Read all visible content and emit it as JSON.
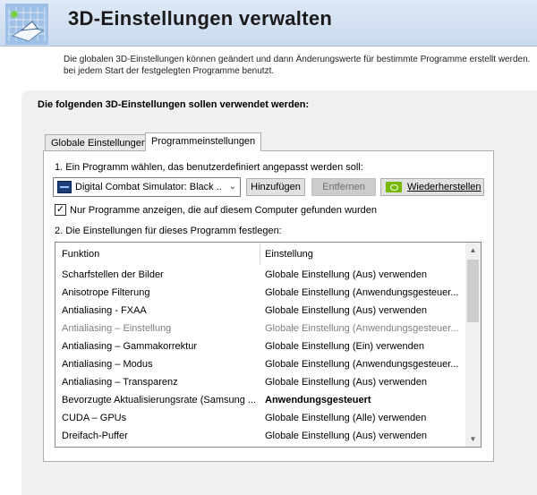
{
  "header": {
    "title": "3D-Einstellungen verwalten",
    "description_line1": "Die globalen 3D-Einstellungen können geändert und dann Änderungswerte für bestimmte Programme erstellt werden.",
    "description_line2": "bei jedem Start der festgelegten Programme benutzt."
  },
  "panel": {
    "heading": "Die folgenden 3D-Einstellungen sollen verwendet werden:"
  },
  "tabs": [
    {
      "label": "Globale Einstellungen",
      "active": false
    },
    {
      "label": "Programmeinstellungen",
      "active": true
    }
  ],
  "program": {
    "step1_label": "1. Ein Programm wählen, das benutzerdefiniert angepasst werden soll:",
    "selected": "Digital Combat Simulator: Black ...",
    "add_button": "Hinzufügen",
    "remove_button": "Entfernen",
    "restore_button": "Wiederherstellen",
    "checkbox_label": "Nur Programme anzeigen, die auf diesem Computer gefunden wurden",
    "checkbox_checked": true,
    "step2_label": "2. Die Einstellungen für dieses Programm festlegen:"
  },
  "table": {
    "columns": [
      "Funktion",
      "Einstellung"
    ],
    "rows": [
      {
        "funktion": "Scharfstellen der Bilder",
        "einstellung": "Globale Einstellung (Aus) verwenden",
        "state": "normal"
      },
      {
        "funktion": "Anisotrope Filterung",
        "einstellung": "Globale Einstellung (Anwendungsgesteuer...",
        "state": "normal"
      },
      {
        "funktion": "Antialiasing - FXAA",
        "einstellung": "Globale Einstellung (Aus) verwenden",
        "state": "normal"
      },
      {
        "funktion": "Antialiasing – Einstellung",
        "einstellung": "Globale Einstellung (Anwendungsgesteuer...",
        "state": "disabled"
      },
      {
        "funktion": "Antialiasing – Gammakorrektur",
        "einstellung": "Globale Einstellung (Ein) verwenden",
        "state": "normal"
      },
      {
        "funktion": "Antialiasing – Modus",
        "einstellung": "Globale Einstellung (Anwendungsgesteuer...",
        "state": "normal"
      },
      {
        "funktion": "Antialiasing – Transparenz",
        "einstellung": "Globale Einstellung (Aus) verwenden",
        "state": "normal"
      },
      {
        "funktion": "Bevorzugte Aktualisierungsrate (Samsung ...",
        "einstellung": "Anwendungsgesteuert",
        "state": "bold"
      },
      {
        "funktion": "CUDA – GPUs",
        "einstellung": "Globale Einstellung (Alle) verwenden",
        "state": "normal"
      },
      {
        "funktion": "Dreifach-Puffer",
        "einstellung": "Globale Einstellung (Aus) verwenden",
        "state": "normal"
      }
    ]
  },
  "icons": {
    "app": "nvidia-3d-settings-icon",
    "restore": "nvidia-icon",
    "dropdown": "chevron-down-icon"
  },
  "colors": {
    "header_bg": "#c9d9ee",
    "panel_bg": "#f0f0f0",
    "disabled_text": "#7f7f7f",
    "nvidia_green": "#76b900"
  }
}
